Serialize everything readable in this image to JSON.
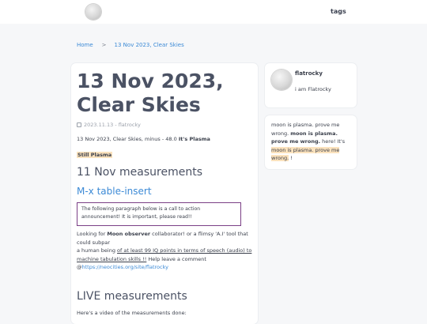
{
  "nav": {
    "tags_label": "tags"
  },
  "breadcrumb": {
    "home": "Home",
    "separator": ">",
    "current": "13 Nov 2023, Clear Skies"
  },
  "post": {
    "title": "13 Nov 2023, Clear Skies",
    "date": "2023.11.13",
    "meta_sep": " - ",
    "author": "flatrocky",
    "subtitle_prefix": "13 Nov 2023, Clear Skies, minus - 48.0 ",
    "subtitle_bold": "It's Plasma",
    "tag_highlight": "Still Plasma",
    "h2_measurements": "11 Nov measurements",
    "h3_link": "M-x table-insert",
    "notice": "The following paragraph below is a call to action announcement! It is important, please read!!",
    "para": {
      "p1": "Looking for ",
      "b1": "Moon observer",
      "p2": " collaborator! or a flimsy 'A.I' tool that could subpar",
      "p3": "a human being ",
      "u1": "of at least 99 IQ points in terms of speech (audio) to machine tabulation skills !!",
      "p4": " Help leave a comment",
      "p5": "@",
      "link": "https://neocities.org/site/flatrocky"
    },
    "h2_live": "LIVE measurements",
    "video_line": "Here's a video of the measurements done:"
  },
  "profile": {
    "name": "flatrocky",
    "bio": "i am Flatrocky"
  },
  "note": {
    "t1": "moon is plasma. prove me wrong. ",
    "b1": "moon is plasma. prove me wrong.",
    "t2": " here! It's ",
    "hl": "moon is plasma. prove me wrong.",
    "t3": " !"
  },
  "colors": {
    "accent": "#3c8ad6",
    "highlight": "#fbe2bd",
    "notice_border": "#7b3f86"
  },
  "icons": {
    "logo": "moon-logo-icon",
    "calendar": "calendar-icon",
    "avatar": "moon-avatar-icon"
  }
}
